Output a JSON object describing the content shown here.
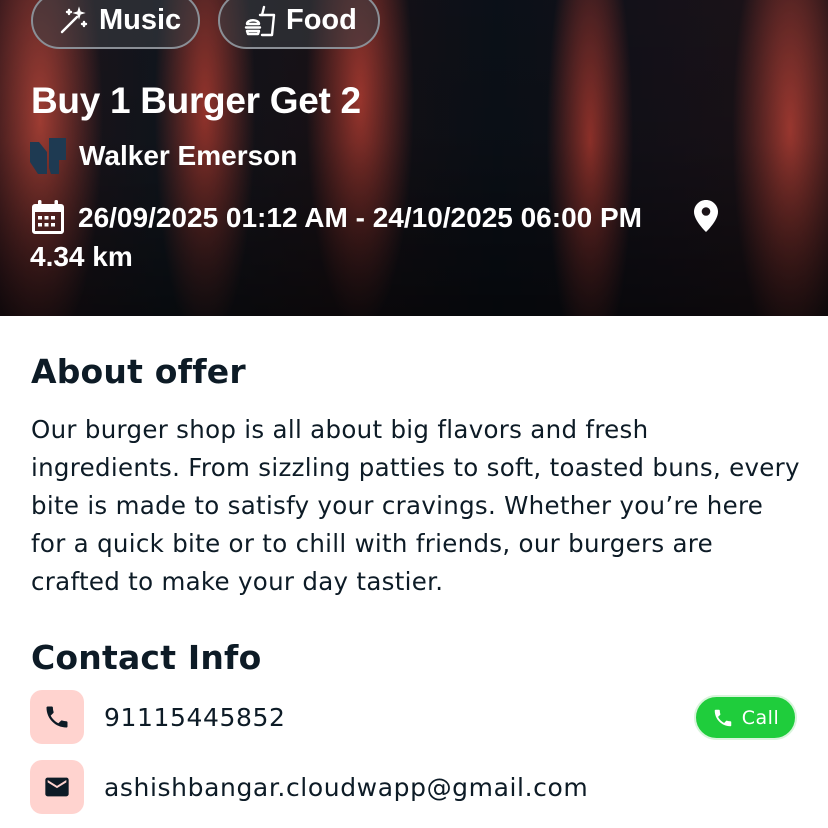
{
  "hero": {
    "tags": [
      {
        "label": "Music",
        "icon": "magic-wand-icon"
      },
      {
        "label": "Food",
        "icon": "food-icon"
      }
    ],
    "title": "Buy 1 Burger Get 2",
    "organizer": {
      "name": "Walker Emerson",
      "logo_icon": "organizer-logo-icon"
    },
    "date_range": "26/09/2025 01:12 AM - 24/10/2025 06:00 PM",
    "distance": "4.34 km"
  },
  "about": {
    "title": "About offer",
    "text": "Our burger shop is all about big flavors and fresh ingredients. From sizzling patties to soft, toasted buns, every bite is made to satisfy your cravings. Whether you’re here for a quick bite or to chill with friends, our burgers are crafted to make your day tastier."
  },
  "contact": {
    "title": "Contact Info",
    "phone": "91115445852",
    "email": "ashishbangar.cloudwapp@gmail.com",
    "call_label": "Call"
  },
  "colors": {
    "accent_green": "#1fcd3c",
    "icon_badge_bg": "#ffd3cf",
    "text_dark": "#0d1b26"
  }
}
